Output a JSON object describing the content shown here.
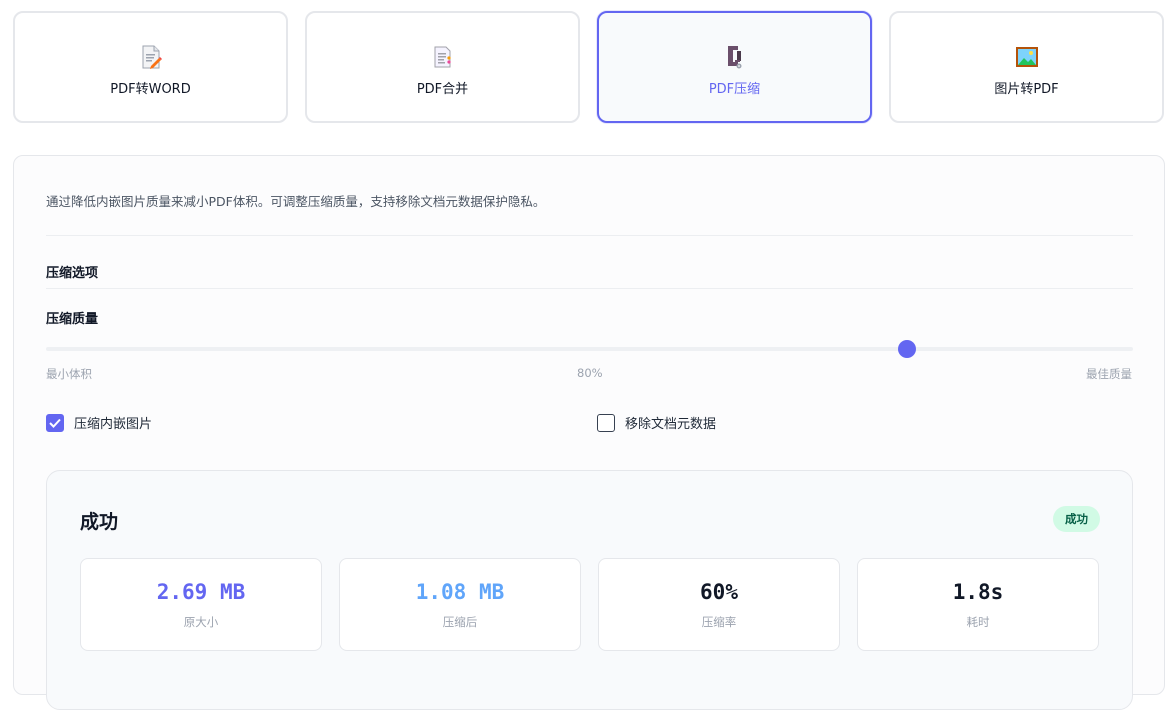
{
  "tabs": [
    {
      "label": "PDF转WORD",
      "icon": "document-edit-icon",
      "active": false
    },
    {
      "label": "PDF合并",
      "icon": "documents-merge-icon",
      "active": false
    },
    {
      "label": "PDF压缩",
      "icon": "clamp-compress-icon",
      "active": true
    },
    {
      "label": "图片转PDF",
      "icon": "framed-picture-icon",
      "active": false
    }
  ],
  "panel": {
    "description": "通过降低内嵌图片质量来减小PDF体积。可调整压缩质量，支持移除文档元数据保护隐私。",
    "section_title": "压缩选项",
    "quality": {
      "title": "压缩质量",
      "min_label": "最小体积",
      "value_label": "80%",
      "max_label": "最佳质量",
      "value": 0.8
    },
    "options": [
      {
        "label": "压缩内嵌图片",
        "checked": true
      },
      {
        "label": "移除文档元数据",
        "checked": false
      }
    ]
  },
  "result": {
    "title": "成功",
    "badge": "成功",
    "stats": [
      {
        "value": "2.69 MB",
        "label": "原大小",
        "color": "#6366f1"
      },
      {
        "value": "1.08 MB",
        "label": "压缩后",
        "color": "#60a5fa"
      },
      {
        "value": "60%",
        "label": "压缩率",
        "color": "#111827"
      },
      {
        "value": "1.8s",
        "label": "耗时",
        "color": "#111827"
      }
    ]
  },
  "colors": {
    "accent": "#6366f1",
    "success_bg": "#d1fae5",
    "success_text": "#065f46"
  }
}
